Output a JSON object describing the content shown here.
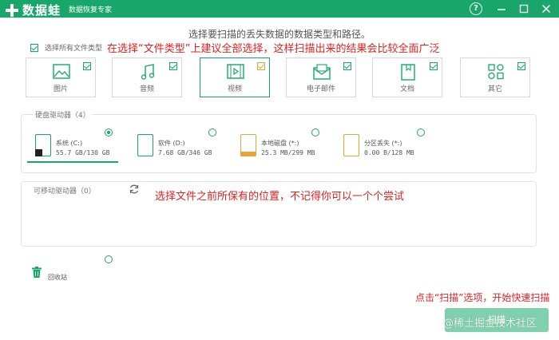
{
  "titlebar": {
    "app_name": "数据蛙",
    "subtitle": "数据恢复专家",
    "help_icon": "question-circle-icon",
    "colors": {
      "brand": "#18a66b"
    }
  },
  "main": {
    "title": "选择要扫描的丢失数据的数据类型和路径。",
    "select_all_label": "选择所有文件类型"
  },
  "annotations": {
    "type_hint": "在选择“文件类型”上建议全部选择，这样扫描出来的结果会比较全面广泛",
    "location_hint": "选择文件之前所保有的位置，不记得你可以一个个尝试",
    "scan_hint": "点击“扫描”选项，开始快速扫描"
  },
  "file_types": [
    {
      "label": "图片",
      "icon": "image-icon",
      "checked": true
    },
    {
      "label": "音频",
      "icon": "music-icon",
      "checked": true
    },
    {
      "label": "视频",
      "icon": "video-icon",
      "checked": true,
      "selected": true
    },
    {
      "label": "电子邮件",
      "icon": "email-icon",
      "checked": true
    },
    {
      "label": "文档",
      "icon": "document-icon",
      "checked": true
    },
    {
      "label": "其它",
      "icon": "other-icon",
      "checked": true
    }
  ],
  "hard_drives": {
    "title": "硬盘驱动器（4）",
    "drives": [
      {
        "name": "系统 (C:)",
        "size": "55.7 GB/130 GB",
        "selected": true
      },
      {
        "name": "软件 (D:)",
        "size": "7.68 GB/346 GB",
        "selected": false
      },
      {
        "name": "本地磁盘 (*:)",
        "size": "25.3 MB/299 MB",
        "selected": false
      },
      {
        "name": "分区丢失 (*:)",
        "size": "0.00  B/128 MB",
        "selected": false
      }
    ]
  },
  "removable": {
    "title": "可移动驱动器（0）"
  },
  "recycle_bin": {
    "label": "回收站"
  },
  "scan_button": {
    "label": "扫描"
  },
  "watermark": "@稀土掘金技术社区"
}
